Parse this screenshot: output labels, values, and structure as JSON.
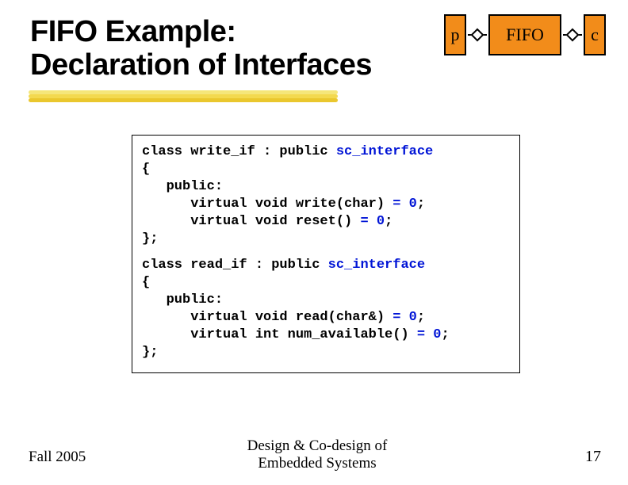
{
  "title": {
    "line1": "FIFO Example:",
    "line2": "Declaration of Interfaces"
  },
  "diagram": {
    "left_box": "p",
    "center_box": "FIFO",
    "right_box": "c"
  },
  "code": {
    "block1": {
      "l1a": "class write_if : public ",
      "l1b": "sc_interface",
      "l2": "{",
      "l3": "   public:",
      "l4a": "      virtual void write(char) ",
      "l4b": "= 0",
      "l4c": ";",
      "l5a": "      virtual void reset() ",
      "l5b": "= 0",
      "l5c": ";",
      "l6": "};"
    },
    "block2": {
      "l1a": "class read_if : public ",
      "l1b": "sc_interface",
      "l2": "{",
      "l3": "   public:",
      "l4a": "      virtual void read(char&) ",
      "l4b": "= 0",
      "l4c": ";",
      "l5a": "      virtual int num_available() ",
      "l5b": "= 0",
      "l5c": ";",
      "l6": "};"
    }
  },
  "footer": {
    "left": "Fall 2005",
    "center1": "Design & Co-design of",
    "center2": "Embedded Systems",
    "right": "17"
  }
}
